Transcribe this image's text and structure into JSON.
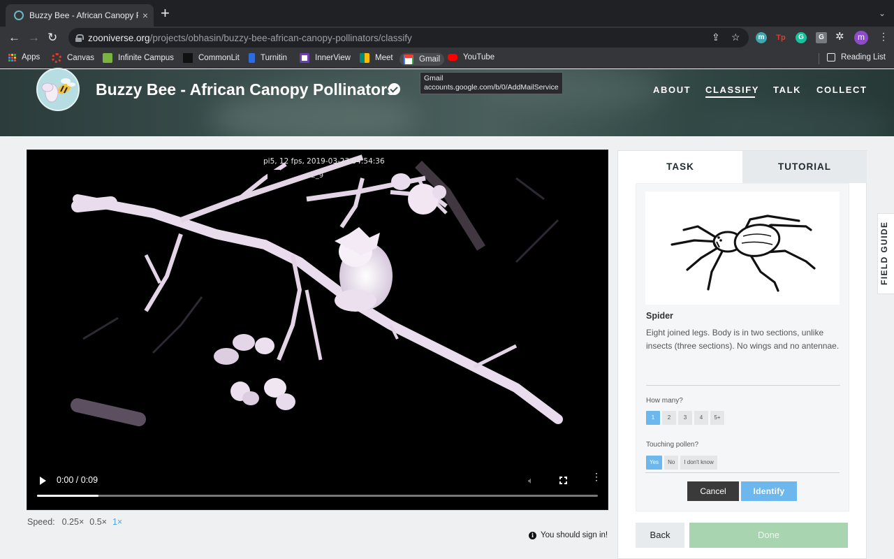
{
  "browser": {
    "tab_title": "Buzzy Bee - African Canopy Po",
    "tab_close": "×",
    "new_tab": "+",
    "url_host": "zooniverse.org",
    "url_path": "/projects/obhasin/buzzy-bee-african-canopy-pollinators/classify",
    "profile_initial": "m",
    "extensions": [
      {
        "name": "m-extension",
        "label": "m",
        "color": "#3ea7b0"
      },
      {
        "name": "tp-extension",
        "label": "Tp",
        "color": "#e03a2f"
      },
      {
        "name": "grammarly-extension",
        "label": "G",
        "color": "#15c39a"
      },
      {
        "name": "g-extension",
        "label": "G",
        "color": "#777a7e"
      }
    ],
    "bookmarks": [
      {
        "label": "Apps",
        "icon": "apps-grid-icon"
      },
      {
        "label": "Canvas",
        "icon": "canvas-icon",
        "color": "#e03a2f"
      },
      {
        "label": "Infinite Campus",
        "icon": "infinite-campus-icon",
        "color": "#7ab342"
      },
      {
        "label": "CommonLit",
        "icon": "commonlit-icon",
        "color": "#111"
      },
      {
        "label": "Turnitin",
        "icon": "turnitin-icon",
        "color": "#2d6cdf"
      },
      {
        "label": "InnerView",
        "icon": "innerview-icon",
        "color": "#6a3fb0"
      },
      {
        "label": "Meet",
        "icon": "meet-icon",
        "color": "#00897b"
      },
      {
        "label": "Gmail",
        "icon": "gmail-icon",
        "color": "#ea4335"
      },
      {
        "label": "YouTube",
        "icon": "youtube-icon",
        "color": "#ff0000"
      }
    ],
    "reading_list": "Reading List",
    "tooltip": {
      "title": "Gmail",
      "url": "accounts.google.com/b/0/AddMailService"
    }
  },
  "project": {
    "title": "Buzzy Bee - African Canopy Pollinators",
    "nav": [
      "ABOUT",
      "CLASSIFY",
      "TALK",
      "COLLECT"
    ],
    "active_nav": "CLASSIFY"
  },
  "video": {
    "overlay_timestamp": "pi5, 12 fps, 2019-03-23 04:54:36",
    "overlay_id": "72_9",
    "time": "0:00 / 0:09",
    "progress": 0.11
  },
  "speed": {
    "label": "Speed:",
    "options": [
      "0.25×",
      "0.5×",
      "1×"
    ],
    "active": "1×"
  },
  "signin_notice": "You should sign in!",
  "panel": {
    "tabs": [
      "TASK",
      "TUTORIAL"
    ],
    "active_tab": "TASK",
    "species_name": "Spider",
    "species_description": "Eight joined legs. Body is in two sections, unlike insects (three sections). No wings and no antennae.",
    "how_many_label": "How many?",
    "how_many_options": [
      "1",
      "2",
      "3",
      "4",
      "5+"
    ],
    "how_many_selected": "1",
    "pollen_label": "Touching pollen?",
    "pollen_options": [
      "Yes",
      "No",
      "I don't know"
    ],
    "pollen_selected": "Yes",
    "cancel": "Cancel",
    "identify": "Identify"
  },
  "footer": {
    "back": "Back",
    "done": "Done"
  },
  "field_guide": "FIELD GUIDE"
}
